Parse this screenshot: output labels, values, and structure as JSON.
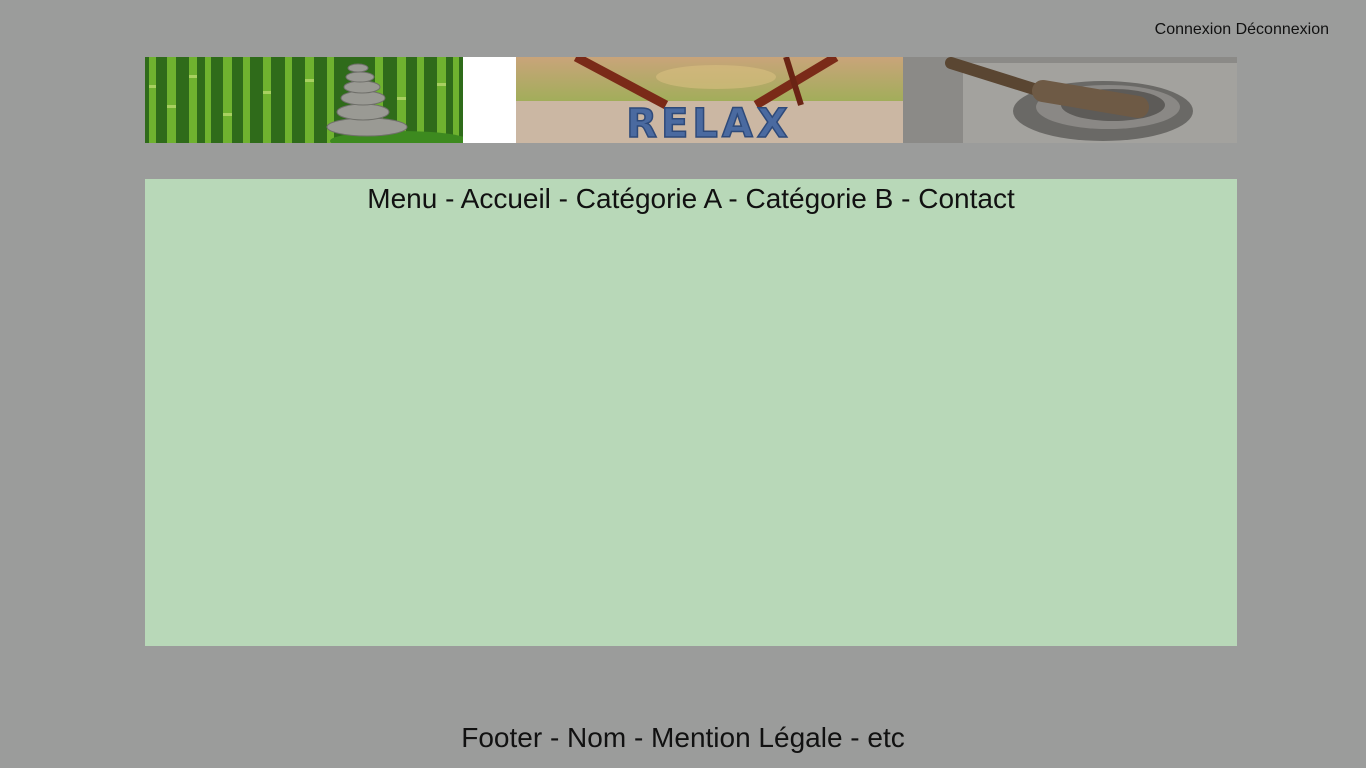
{
  "header": {
    "login": "Connexion",
    "logout": "Déconnexion"
  },
  "banner": {
    "images": [
      "bamboo-stones-image",
      "relax-image",
      "mortar-pestle-image"
    ],
    "relax_text": "RELAX"
  },
  "nav": {
    "prefix": "Menu",
    "separator": " - ",
    "items": [
      "Accueil",
      "Catégorie A",
      "Catégorie B",
      "Contact"
    ]
  },
  "footer": {
    "text": "Footer - Nom - Mention Légale - etc"
  },
  "colors": {
    "page_background": "#9b9c9b",
    "content_background": "#b8d8b8"
  }
}
